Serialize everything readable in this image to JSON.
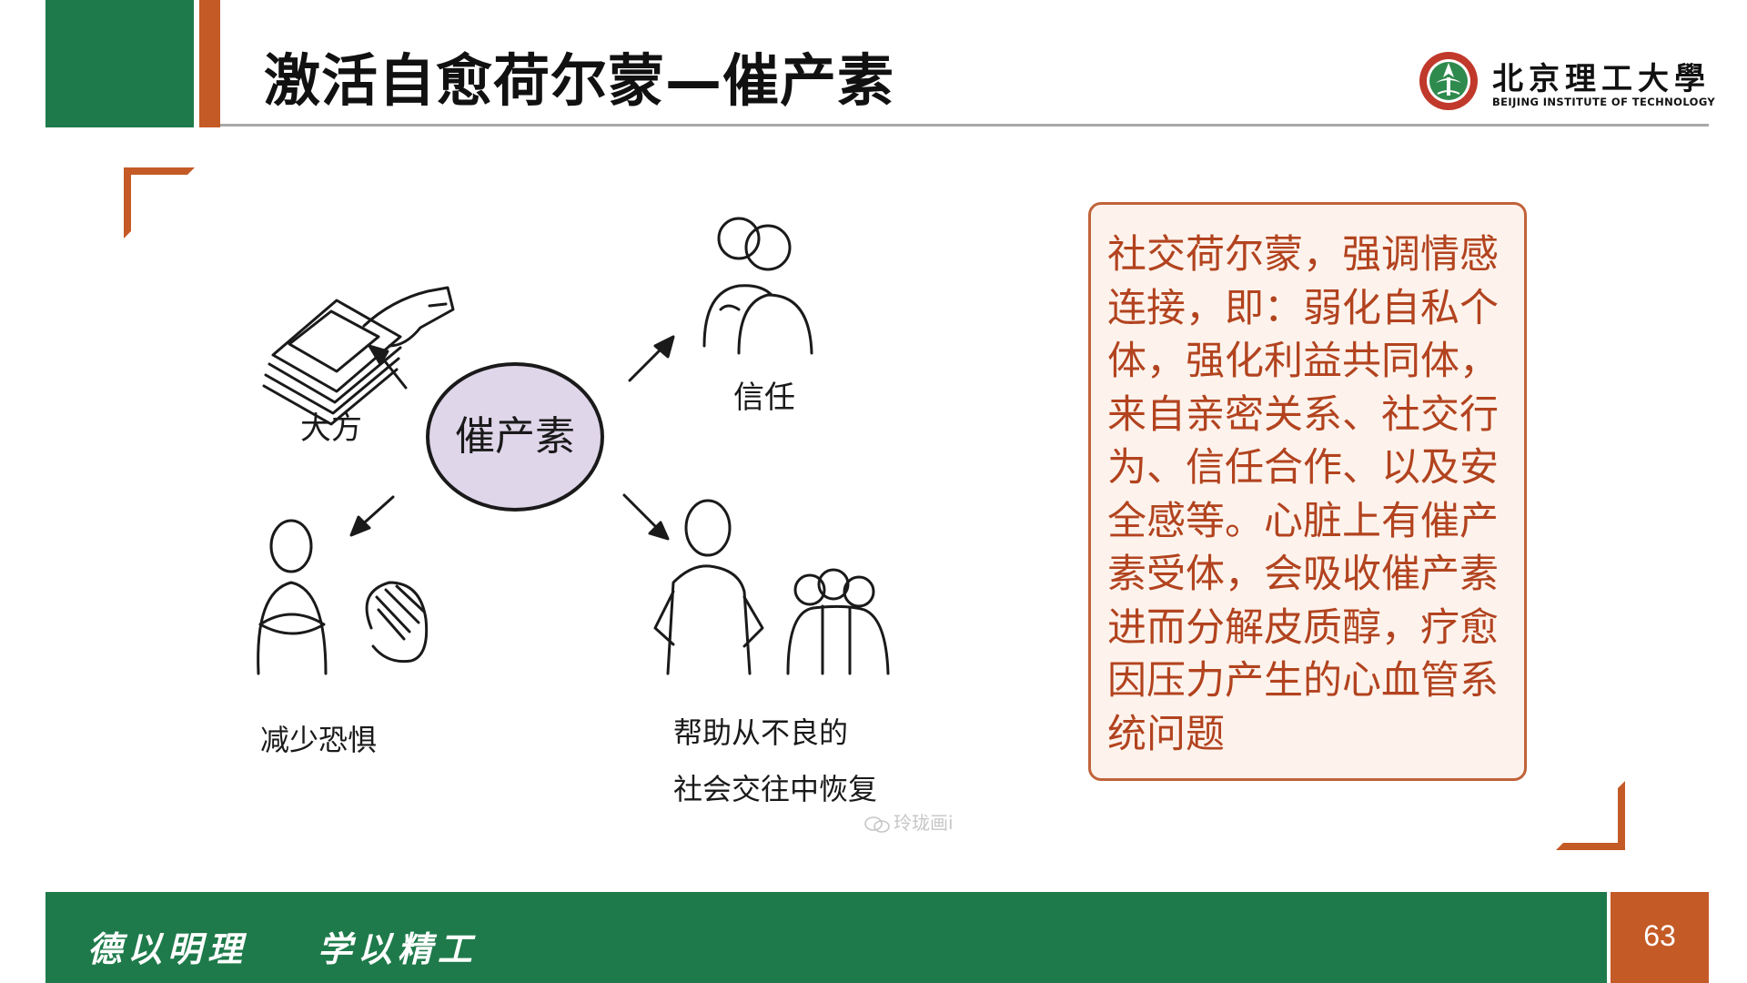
{
  "slide": {
    "title": "激活自愈荷尔蒙—催产素",
    "page_number": "63"
  },
  "logo": {
    "name_cn": "北京理工大學",
    "name_en": "BEIJING INSTITUTE OF TECHNOLOGY"
  },
  "illustration": {
    "center_label": "催产素",
    "labels": {
      "generous": "大方",
      "trust": "信任",
      "reduce_fear": "减少恐惧",
      "recover_line1": "帮助从不良的",
      "recover_line2": "社会交往中恢复"
    },
    "watermark": "玲珑画i"
  },
  "textbox": {
    "body": "社交荷尔蒙，强调情感连接，即：弱化自私个体，强化利益共同体，来自亲密关系、社交行为、信任合作、以及安全感等。心脏上有催产素受体，会吸收催产素进而分解皮质醇，疗愈因压力产生的心血管系统问题"
  },
  "footer": {
    "motto": "德以明理    学以精工"
  },
  "colors": {
    "green": "#1e7a4a",
    "orange": "#c45a26",
    "text_red": "#b2431f",
    "box_bg": "#fdf3ec",
    "bubble": "#e0d6ea"
  }
}
